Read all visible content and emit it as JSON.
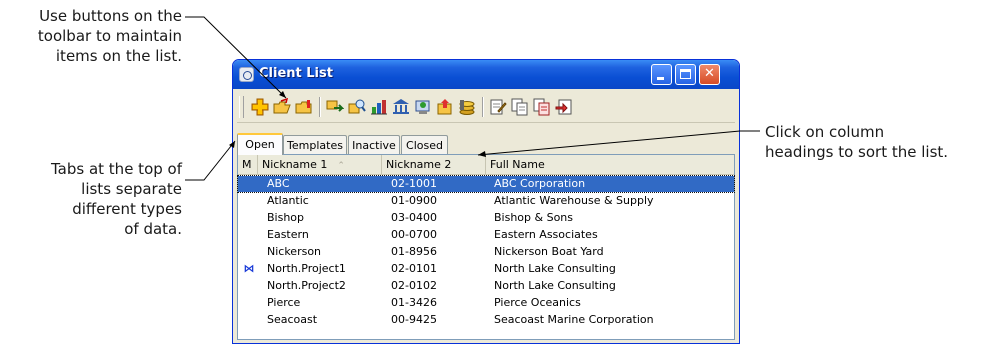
{
  "callouts": {
    "toolbar": [
      "Use buttons on the",
      "toolbar to maintain",
      "items on the list."
    ],
    "tabs": [
      "Tabs at the top of",
      "lists separate",
      "different types",
      "of data."
    ],
    "sort": [
      "Click on column",
      "headings to sort the list."
    ]
  },
  "window": {
    "title": "Client List",
    "controls": {
      "minimize": "minimize",
      "maximize": "maximize",
      "close": "close"
    }
  },
  "toolbar": {
    "icons": [
      "add-icon",
      "open-folder-icon",
      "edit-folder-icon",
      "transfer-icon",
      "find-icon",
      "reports-icon",
      "bank-icon",
      "client-icon",
      "export-icon",
      "coins-icon",
      "note-icon",
      "copy-icon",
      "duplicate-icon",
      "import-icon"
    ]
  },
  "tabs": [
    "Open",
    "Templates",
    "Inactive",
    "Closed"
  ],
  "list": {
    "columns": [
      "M",
      "Nickname 1",
      "Nickname 2",
      "Full Name"
    ],
    "sort_indicator": "⌃",
    "marker_glyph": "⋈",
    "rows": [
      {
        "m": "",
        "nick1": "ABC",
        "nick2": "02-1001",
        "full": "ABC Corporation",
        "selected": true
      },
      {
        "m": "",
        "nick1": "Atlantic",
        "nick2": "01-0900",
        "full": "Atlantic Warehouse & Supply"
      },
      {
        "m": "",
        "nick1": "Bishop",
        "nick2": "03-0400",
        "full": "Bishop & Sons"
      },
      {
        "m": "",
        "nick1": "Eastern",
        "nick2": "00-0700",
        "full": "Eastern Associates"
      },
      {
        "m": "",
        "nick1": "Nickerson",
        "nick2": "01-8956",
        "full": "Nickerson Boat Yard"
      },
      {
        "m": "⋈",
        "nick1": "North.Project1",
        "nick2": "02-0101",
        "full": "North Lake Consulting"
      },
      {
        "m": "",
        "nick1": "North.Project2",
        "nick2": "02-0102",
        "full": "North Lake Consulting"
      },
      {
        "m": "",
        "nick1": "Pierce",
        "nick2": "01-3426",
        "full": "Pierce Oceanics"
      },
      {
        "m": "",
        "nick1": "Seacoast",
        "nick2": "00-9425",
        "full": "Seacoast Marine Corporation"
      }
    ]
  },
  "colors": {
    "title_bar": "#0a4fd4",
    "selection": "#316ac5",
    "active_tab_accent": "#ffc83c"
  }
}
